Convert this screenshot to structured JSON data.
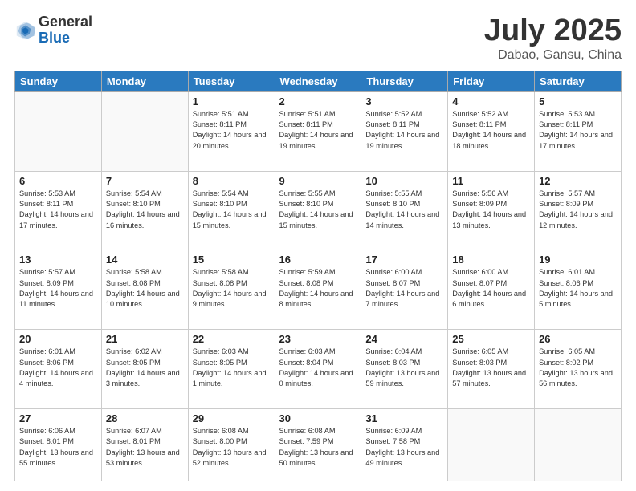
{
  "header": {
    "logo_general": "General",
    "logo_blue": "Blue",
    "month_title": "July 2025",
    "subtitle": "Dabao, Gansu, China"
  },
  "weekdays": [
    "Sunday",
    "Monday",
    "Tuesday",
    "Wednesday",
    "Thursday",
    "Friday",
    "Saturday"
  ],
  "weeks": [
    [
      {
        "day": "",
        "info": ""
      },
      {
        "day": "",
        "info": ""
      },
      {
        "day": "1",
        "info": "Sunrise: 5:51 AM\nSunset: 8:11 PM\nDaylight: 14 hours\nand 20 minutes."
      },
      {
        "day": "2",
        "info": "Sunrise: 5:51 AM\nSunset: 8:11 PM\nDaylight: 14 hours\nand 19 minutes."
      },
      {
        "day": "3",
        "info": "Sunrise: 5:52 AM\nSunset: 8:11 PM\nDaylight: 14 hours\nand 19 minutes."
      },
      {
        "day": "4",
        "info": "Sunrise: 5:52 AM\nSunset: 8:11 PM\nDaylight: 14 hours\nand 18 minutes."
      },
      {
        "day": "5",
        "info": "Sunrise: 5:53 AM\nSunset: 8:11 PM\nDaylight: 14 hours\nand 17 minutes."
      }
    ],
    [
      {
        "day": "6",
        "info": "Sunrise: 5:53 AM\nSunset: 8:11 PM\nDaylight: 14 hours\nand 17 minutes."
      },
      {
        "day": "7",
        "info": "Sunrise: 5:54 AM\nSunset: 8:10 PM\nDaylight: 14 hours\nand 16 minutes."
      },
      {
        "day": "8",
        "info": "Sunrise: 5:54 AM\nSunset: 8:10 PM\nDaylight: 14 hours\nand 15 minutes."
      },
      {
        "day": "9",
        "info": "Sunrise: 5:55 AM\nSunset: 8:10 PM\nDaylight: 14 hours\nand 15 minutes."
      },
      {
        "day": "10",
        "info": "Sunrise: 5:55 AM\nSunset: 8:10 PM\nDaylight: 14 hours\nand 14 minutes."
      },
      {
        "day": "11",
        "info": "Sunrise: 5:56 AM\nSunset: 8:09 PM\nDaylight: 14 hours\nand 13 minutes."
      },
      {
        "day": "12",
        "info": "Sunrise: 5:57 AM\nSunset: 8:09 PM\nDaylight: 14 hours\nand 12 minutes."
      }
    ],
    [
      {
        "day": "13",
        "info": "Sunrise: 5:57 AM\nSunset: 8:09 PM\nDaylight: 14 hours\nand 11 minutes."
      },
      {
        "day": "14",
        "info": "Sunrise: 5:58 AM\nSunset: 8:08 PM\nDaylight: 14 hours\nand 10 minutes."
      },
      {
        "day": "15",
        "info": "Sunrise: 5:58 AM\nSunset: 8:08 PM\nDaylight: 14 hours\nand 9 minutes."
      },
      {
        "day": "16",
        "info": "Sunrise: 5:59 AM\nSunset: 8:08 PM\nDaylight: 14 hours\nand 8 minutes."
      },
      {
        "day": "17",
        "info": "Sunrise: 6:00 AM\nSunset: 8:07 PM\nDaylight: 14 hours\nand 7 minutes."
      },
      {
        "day": "18",
        "info": "Sunrise: 6:00 AM\nSunset: 8:07 PM\nDaylight: 14 hours\nand 6 minutes."
      },
      {
        "day": "19",
        "info": "Sunrise: 6:01 AM\nSunset: 8:06 PM\nDaylight: 14 hours\nand 5 minutes."
      }
    ],
    [
      {
        "day": "20",
        "info": "Sunrise: 6:01 AM\nSunset: 8:06 PM\nDaylight: 14 hours\nand 4 minutes."
      },
      {
        "day": "21",
        "info": "Sunrise: 6:02 AM\nSunset: 8:05 PM\nDaylight: 14 hours\nand 3 minutes."
      },
      {
        "day": "22",
        "info": "Sunrise: 6:03 AM\nSunset: 8:05 PM\nDaylight: 14 hours\nand 1 minute."
      },
      {
        "day": "23",
        "info": "Sunrise: 6:03 AM\nSunset: 8:04 PM\nDaylight: 14 hours\nand 0 minutes."
      },
      {
        "day": "24",
        "info": "Sunrise: 6:04 AM\nSunset: 8:03 PM\nDaylight: 13 hours\nand 59 minutes."
      },
      {
        "day": "25",
        "info": "Sunrise: 6:05 AM\nSunset: 8:03 PM\nDaylight: 13 hours\nand 57 minutes."
      },
      {
        "day": "26",
        "info": "Sunrise: 6:05 AM\nSunset: 8:02 PM\nDaylight: 13 hours\nand 56 minutes."
      }
    ],
    [
      {
        "day": "27",
        "info": "Sunrise: 6:06 AM\nSunset: 8:01 PM\nDaylight: 13 hours\nand 55 minutes."
      },
      {
        "day": "28",
        "info": "Sunrise: 6:07 AM\nSunset: 8:01 PM\nDaylight: 13 hours\nand 53 minutes."
      },
      {
        "day": "29",
        "info": "Sunrise: 6:08 AM\nSunset: 8:00 PM\nDaylight: 13 hours\nand 52 minutes."
      },
      {
        "day": "30",
        "info": "Sunrise: 6:08 AM\nSunset: 7:59 PM\nDaylight: 13 hours\nand 50 minutes."
      },
      {
        "day": "31",
        "info": "Sunrise: 6:09 AM\nSunset: 7:58 PM\nDaylight: 13 hours\nand 49 minutes."
      },
      {
        "day": "",
        "info": ""
      },
      {
        "day": "",
        "info": ""
      }
    ]
  ]
}
